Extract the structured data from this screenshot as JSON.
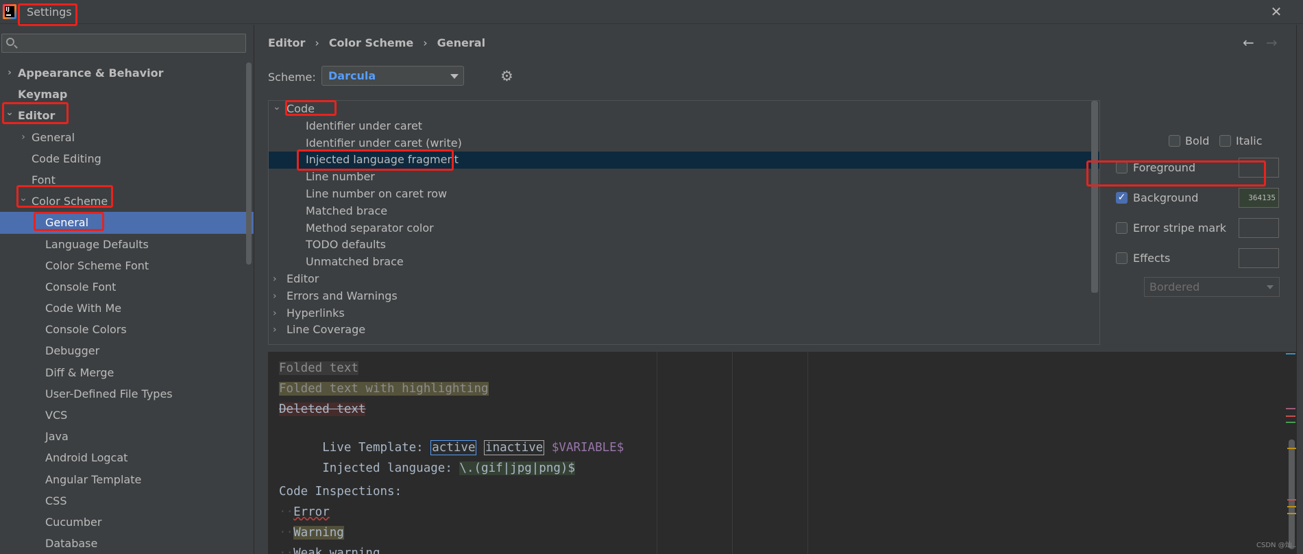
{
  "window": {
    "title": "Settings",
    "close": "✕"
  },
  "search": {
    "placeholder": "",
    "value": ""
  },
  "sidebar": {
    "items": [
      {
        "label": "Appearance & Behavior",
        "chevron": "›"
      },
      {
        "label": "Keymap"
      },
      {
        "label": "Editor",
        "chevron": "⌄"
      },
      {
        "label": "General",
        "chevron": "›"
      },
      {
        "label": "Code Editing"
      },
      {
        "label": "Font"
      },
      {
        "label": "Color Scheme",
        "chevron": "⌄"
      },
      {
        "label": "General"
      },
      {
        "label": "Language Defaults"
      },
      {
        "label": "Color Scheme Font"
      },
      {
        "label": "Console Font"
      },
      {
        "label": "Code With Me"
      },
      {
        "label": "Console Colors"
      },
      {
        "label": "Debugger"
      },
      {
        "label": "Diff & Merge"
      },
      {
        "label": "User-Defined File Types"
      },
      {
        "label": "VCS"
      },
      {
        "label": "Java"
      },
      {
        "label": "Android Logcat"
      },
      {
        "label": "Angular Template"
      },
      {
        "label": "CSS"
      },
      {
        "label": "Cucumber"
      },
      {
        "label": "Database"
      }
    ]
  },
  "breadcrumb": {
    "items": [
      "Editor",
      "Color Scheme",
      "General"
    ],
    "separator": "›"
  },
  "nav": {
    "back": "←",
    "forward": "→"
  },
  "scheme": {
    "label": "Scheme:",
    "value": "Darcula"
  },
  "attributes": {
    "items": [
      {
        "label": "Code",
        "chevron": "⌄"
      },
      {
        "label": "Identifier under caret"
      },
      {
        "label": "Identifier under caret (write)"
      },
      {
        "label": "Injected language fragment"
      },
      {
        "label": "Line number"
      },
      {
        "label": "Line number on caret row"
      },
      {
        "label": "Matched brace"
      },
      {
        "label": "Method separator color"
      },
      {
        "label": "TODO defaults"
      },
      {
        "label": "Unmatched brace"
      },
      {
        "label": "Editor",
        "chevron": "›"
      },
      {
        "label": "Errors and Warnings",
        "chevron": "›"
      },
      {
        "label": "Hyperlinks",
        "chevron": "›"
      },
      {
        "label": "Line Coverage",
        "chevron": "›"
      }
    ]
  },
  "options": {
    "bold": "Bold",
    "italic": "Italic",
    "foreground": "Foreground",
    "background": "Background",
    "background_value": "364135",
    "background_checked": true,
    "error_stripe": "Error stripe mark",
    "effects": "Effects",
    "effect_type": "Bordered",
    "check_mark": "✓"
  },
  "preview": {
    "folded": "Folded text",
    "folded_hl": "Folded text with highlighting",
    "deleted": "Deleted text",
    "live_template_label": "Live Template: ",
    "lt_active": "active",
    "lt_inactive": "inactive",
    "lt_variable": "$VARIABLE$",
    "injected_label": "Injected language: ",
    "injected_value": "\\.(gif|jpg|png)$",
    "inspections": "Code Inspections:",
    "error": "Error",
    "warning": "Warning",
    "next_line": "Weak warning"
  },
  "watermark": "CSDN @灿..",
  "colors": {
    "selection": "#4b6eaf",
    "link": "#589df6",
    "injected_bg": "#364135",
    "annotation": "#e8231e"
  }
}
